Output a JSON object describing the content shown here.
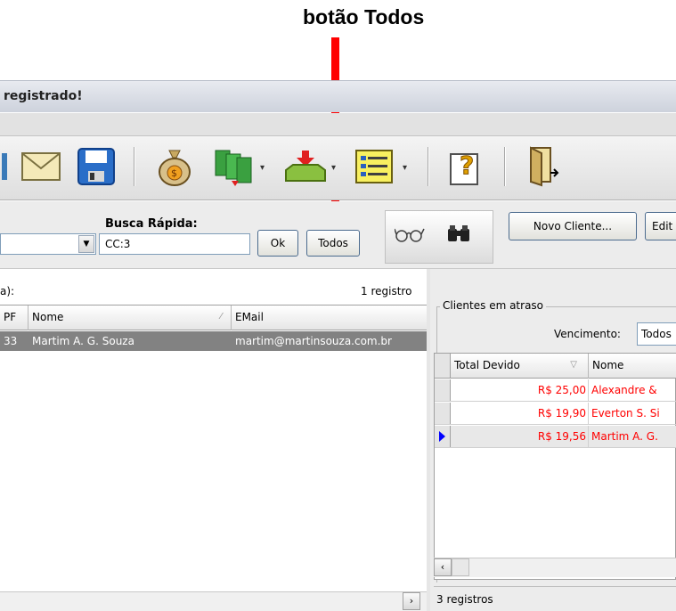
{
  "annotation": {
    "title": "botão Todos"
  },
  "window": {
    "title": "registrado!"
  },
  "toolbar": {
    "icons": [
      "mail-icon",
      "save-icon",
      "money-bag-icon",
      "cash-stack-icon",
      "inbox-download-icon",
      "list-sheet-icon",
      "help-icon",
      "exit-door-icon"
    ]
  },
  "search": {
    "label": "Busca Rápida:",
    "value": "CC:3",
    "ok_label": "Ok",
    "todos_label": "Todos"
  },
  "actions": {
    "novo_cliente": "Novo Cliente...",
    "edit": "Edit"
  },
  "clients": {
    "label": "a):",
    "count": "1 registro",
    "columns": [
      "PF",
      "Nome",
      "EMail"
    ],
    "selected_row": {
      "pf": "33",
      "nome": "Martim A. G. Souza",
      "email": "martim@martinsouza.com.br"
    }
  },
  "overdue": {
    "group_title": "Clientes em atraso",
    "vencimento_label": "Vencimento:",
    "vencimento_value": "Todos",
    "columns": [
      "Total Devido",
      "Nome"
    ],
    "rows": [
      {
        "total": "R$ 25,00",
        "nome": "Alexandre & "
      },
      {
        "total": "R$ 19,90",
        "nome": "Everton S. Si"
      },
      {
        "total": "R$ 19,56",
        "nome": "Martim A. G."
      }
    ],
    "status": "3 registros"
  },
  "colors": {
    "accent": "#ff0000",
    "selection": "#828282",
    "overdue_text": "#ff0000"
  }
}
